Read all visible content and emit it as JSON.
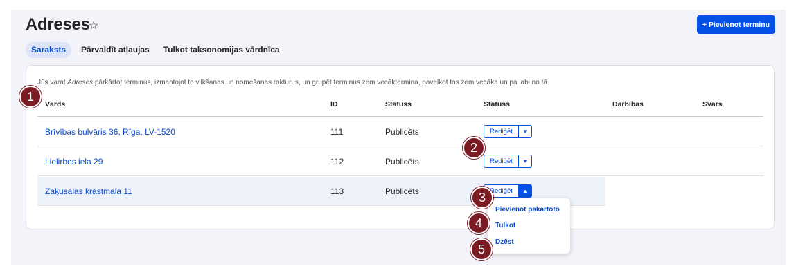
{
  "page": {
    "title": "Adreses",
    "add_button_label": "+ Pievienot terminu"
  },
  "tabs": [
    {
      "label": "Saraksts",
      "active": true
    },
    {
      "label": "Pārvaldīt atļaujas",
      "active": false
    },
    {
      "label": "Tulkot taksonomijas vārdnīca",
      "active": false
    }
  ],
  "description": {
    "before": "Jūs varat ",
    "emphasis": "Adreses",
    "after": " pārkārtot terminus, izmantojot to vilkšanas un nomešanas rokturus, un grupēt terminus zem vecāktermina, pavelkot tos zem vecāka un pa labi no tā."
  },
  "table": {
    "headers": [
      "Vārds",
      "ID",
      "Statuss",
      "Statuss",
      "Darbības",
      "Svars"
    ],
    "rows": [
      {
        "name": "Brīvības bulvāris 36, Rīga, LV-1520",
        "id": "111",
        "status": "Publicēts",
        "action_label": "Rediģēt"
      },
      {
        "name": "Lielirbes iela 29",
        "id": "112",
        "status": "Publicēts",
        "action_label": "Rediģēt"
      },
      {
        "name": "Zaķusalas krastmala 11",
        "id": "113",
        "status": "Publicēts",
        "action_label": "Rediģēt"
      }
    ]
  },
  "dropdown_menu": {
    "items": [
      "Pievienot pakārtoto",
      "Tulkot",
      "Dzēst"
    ]
  },
  "annotations": [
    "1",
    "2",
    "3",
    "4",
    "5"
  ],
  "colors": {
    "accent": "#0550e6",
    "link": "#0c4bce",
    "annotation_badge": "#7b1c25",
    "page_background": "#f3f4f9"
  },
  "icons": {
    "favorite": "star-outline-icon",
    "dropdown_closed": "chevron-down-icon",
    "dropdown_open": "chevron-up-icon"
  }
}
